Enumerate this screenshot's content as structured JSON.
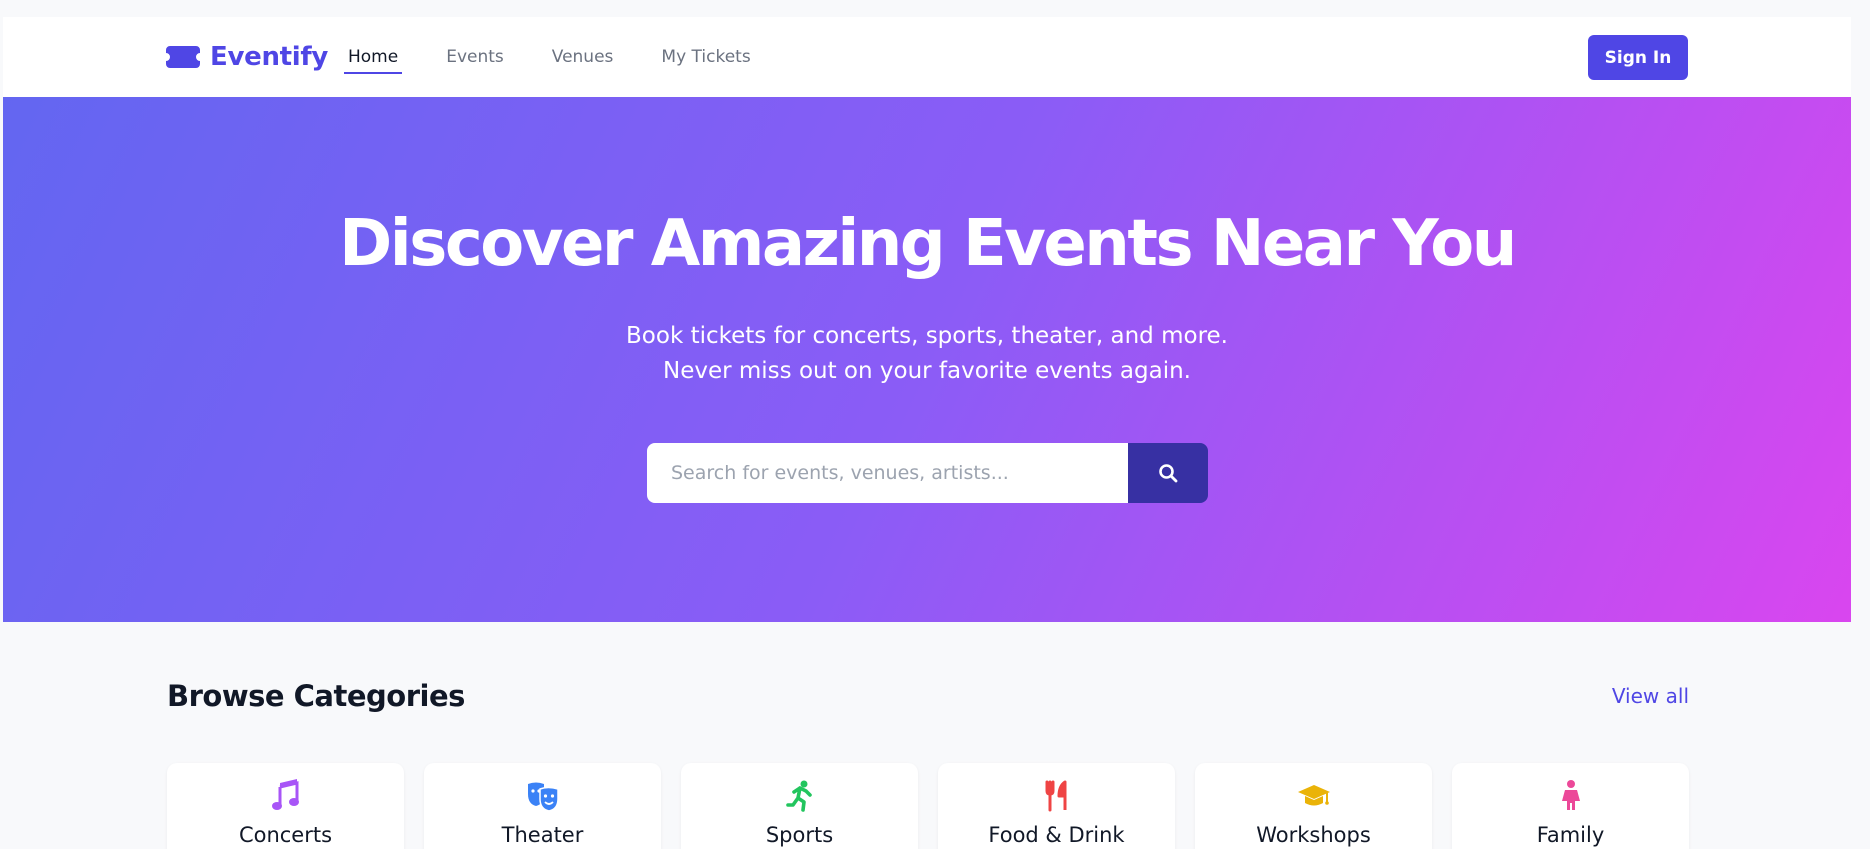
{
  "header": {
    "brand": "Eventify",
    "nav": [
      {
        "label": "Home",
        "active": true
      },
      {
        "label": "Events",
        "active": false
      },
      {
        "label": "Venues",
        "active": false
      },
      {
        "label": "My Tickets",
        "active": false
      }
    ],
    "signin_label": "Sign In"
  },
  "hero": {
    "title": "Discover Amazing Events Near You",
    "subtitle_line1": "Book tickets for concerts, sports, theater, and more.",
    "subtitle_line2": "Never miss out on your favorite events again.",
    "search_placeholder": "Search for events, venues, artists...",
    "search_value": ""
  },
  "categories": {
    "title": "Browse Categories",
    "view_all": "View all",
    "items": [
      {
        "label": "Concerts",
        "icon": "music-icon",
        "color": "#a855f7"
      },
      {
        "label": "Theater",
        "icon": "theater-masks-icon",
        "color": "#3b82f6"
      },
      {
        "label": "Sports",
        "icon": "running-icon",
        "color": "#22c55e"
      },
      {
        "label": "Food & Drink",
        "icon": "utensils-icon",
        "color": "#ef4444"
      },
      {
        "label": "Workshops",
        "icon": "graduation-cap-icon",
        "color": "#eab308"
      },
      {
        "label": "Family",
        "icon": "child-icon",
        "color": "#ec4899"
      }
    ]
  },
  "colors": {
    "brand": "#4f46e5",
    "search_button": "#3730a3",
    "hero_gradient": [
      "#6366f1",
      "#8b5cf6",
      "#d946ef"
    ]
  }
}
